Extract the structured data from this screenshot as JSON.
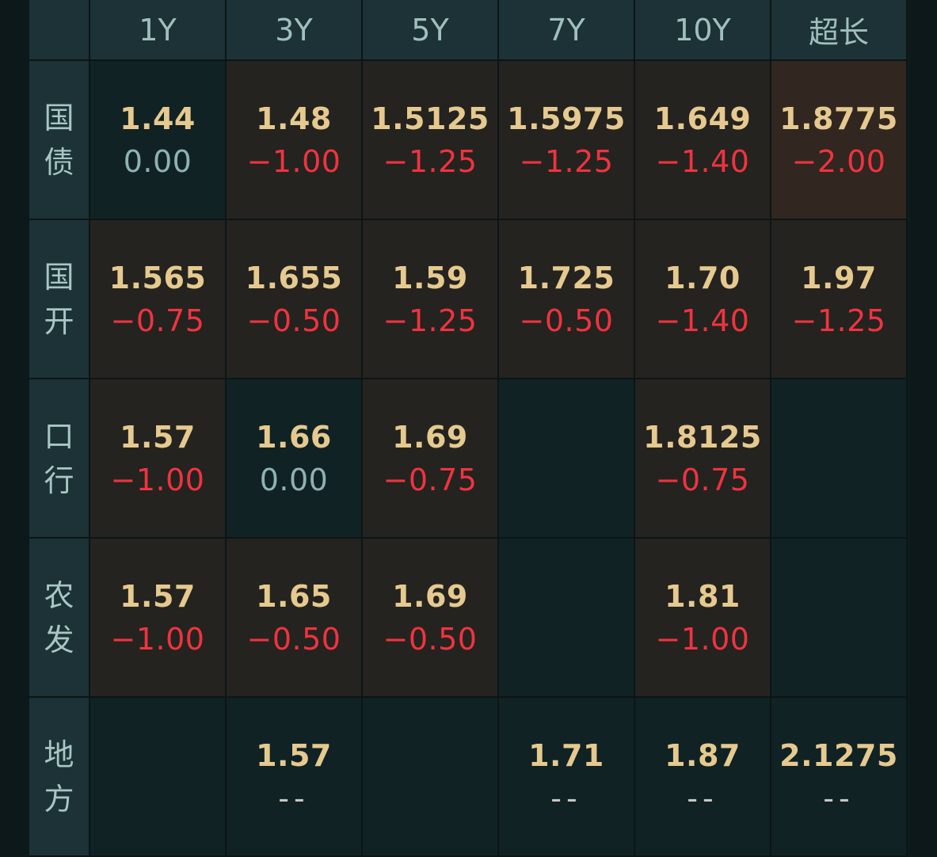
{
  "columns": [
    "1Y",
    "3Y",
    "5Y",
    "7Y",
    "10Y",
    "超长"
  ],
  "rows": [
    {
      "label": [
        "国",
        "债"
      ],
      "cells": [
        {
          "price": "1.44",
          "change": "0.00",
          "tone": "dark",
          "sign": "zero"
        },
        {
          "price": "1.48",
          "change": "-1.00",
          "tone": "neutral",
          "sign": "neg"
        },
        {
          "price": "1.5125",
          "change": "-1.25",
          "tone": "neutral",
          "sign": "neg"
        },
        {
          "price": "1.5975",
          "change": "-1.25",
          "tone": "neutral",
          "sign": "neg"
        },
        {
          "price": "1.649",
          "change": "-1.40",
          "tone": "neutral",
          "sign": "neg"
        },
        {
          "price": "1.8775",
          "change": "-2.00",
          "tone": "warm",
          "sign": "neg"
        }
      ]
    },
    {
      "label": [
        "国",
        "开"
      ],
      "cells": [
        {
          "price": "1.565",
          "change": "-0.75",
          "tone": "neutral",
          "sign": "neg"
        },
        {
          "price": "1.655",
          "change": "-0.50",
          "tone": "neutral",
          "sign": "neg"
        },
        {
          "price": "1.59",
          "change": "-1.25",
          "tone": "neutral",
          "sign": "neg"
        },
        {
          "price": "1.725",
          "change": "-0.50",
          "tone": "neutral",
          "sign": "neg"
        },
        {
          "price": "1.70",
          "change": "-1.40",
          "tone": "neutral",
          "sign": "neg"
        },
        {
          "price": "1.97",
          "change": "-1.25",
          "tone": "neutral",
          "sign": "neg"
        }
      ]
    },
    {
      "label": [
        "口",
        "行"
      ],
      "cells": [
        {
          "price": "1.57",
          "change": "-1.00",
          "tone": "neutral",
          "sign": "neg"
        },
        {
          "price": "1.66",
          "change": "0.00",
          "tone": "dark",
          "sign": "zero"
        },
        {
          "price": "1.69",
          "change": "-0.75",
          "tone": "neutral",
          "sign": "neg"
        },
        {
          "price": "",
          "change": "",
          "tone": "dark",
          "sign": "none"
        },
        {
          "price": "1.8125",
          "change": "-0.75",
          "tone": "neutral",
          "sign": "neg"
        },
        {
          "price": "",
          "change": "",
          "tone": "dark",
          "sign": "none"
        }
      ]
    },
    {
      "label": [
        "农",
        "发"
      ],
      "cells": [
        {
          "price": "1.57",
          "change": "-1.00",
          "tone": "neutral",
          "sign": "neg"
        },
        {
          "price": "1.65",
          "change": "-0.50",
          "tone": "neutral",
          "sign": "neg"
        },
        {
          "price": "1.69",
          "change": "-0.50",
          "tone": "neutral",
          "sign": "neg"
        },
        {
          "price": "",
          "change": "",
          "tone": "dark",
          "sign": "none"
        },
        {
          "price": "1.81",
          "change": "-1.00",
          "tone": "neutral",
          "sign": "neg"
        },
        {
          "price": "",
          "change": "",
          "tone": "dark",
          "sign": "none"
        }
      ]
    },
    {
      "label": [
        "地",
        "方"
      ],
      "cells": [
        {
          "price": "",
          "change": "",
          "tone": "dark",
          "sign": "none"
        },
        {
          "price": "1.57",
          "change": "--",
          "tone": "dark",
          "sign": "none"
        },
        {
          "price": "",
          "change": "",
          "tone": "dark",
          "sign": "none"
        },
        {
          "price": "1.71",
          "change": "--",
          "tone": "dark",
          "sign": "none"
        },
        {
          "price": "1.87",
          "change": "--",
          "tone": "dark",
          "sign": "none"
        },
        {
          "price": "2.1275",
          "change": "--",
          "tone": "dark",
          "sign": "none"
        }
      ]
    }
  ],
  "colors": {
    "header_bg": "#1d3236",
    "cell_dark": "#102224",
    "cell_neutral": "#24231f",
    "cell_warm": "#312620",
    "price": "#e6c98f",
    "negative": "#f0333f",
    "zero": "#8fb2b1"
  }
}
